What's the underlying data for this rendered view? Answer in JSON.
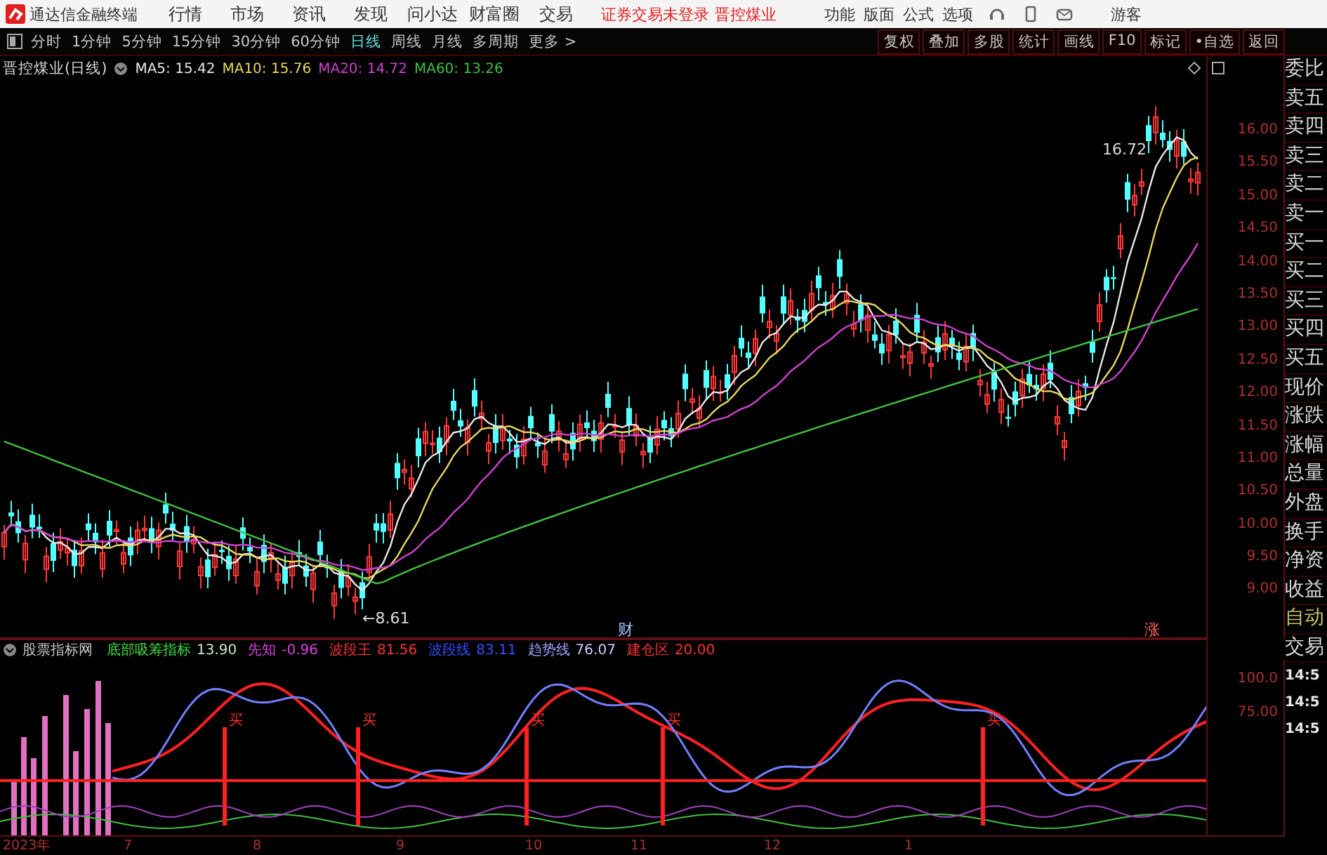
{
  "app_bar": {
    "title": "通达信金融终端",
    "menus": [
      "行情",
      "市场",
      "资讯",
      "发现",
      "问小达",
      "财富圈",
      "交易"
    ],
    "notice": "证券交易未登录",
    "stock_link": "晋控煤业",
    "tools": [
      "功能",
      "版面",
      "公式",
      "选项"
    ],
    "user": "游客"
  },
  "period_bar": {
    "periods": [
      {
        "label": "分时",
        "selected": false
      },
      {
        "label": "1分钟",
        "selected": false
      },
      {
        "label": "5分钟",
        "selected": false
      },
      {
        "label": "15分钟",
        "selected": false
      },
      {
        "label": "30分钟",
        "selected": false
      },
      {
        "label": "60分钟",
        "selected": false
      },
      {
        "label": "日线",
        "selected": true
      },
      {
        "label": "周线",
        "selected": false
      },
      {
        "label": "月线",
        "selected": false
      },
      {
        "label": "多周期",
        "selected": false
      }
    ],
    "more": "更多 >",
    "actions": [
      "复权",
      "叠加",
      "多股",
      "统计",
      "画线",
      "F10",
      "标记",
      "•自选",
      "返回"
    ]
  },
  "main_chart": {
    "title": "晋控煤业(日线)",
    "ma": [
      {
        "label": "MA5: 15.42",
        "color": "#e8e8e8"
      },
      {
        "label": "MA10: 15.76",
        "color": "#e8d860"
      },
      {
        "label": "MA20: 14.72",
        "color": "#d040d0"
      },
      {
        "label": "MA60: 13.26",
        "color": "#40c040"
      }
    ],
    "high_label": "16.72",
    "low_label": "←8.61",
    "event_marks": [
      {
        "text": "财",
        "color": "#a0c8ff"
      },
      {
        "text": "涨",
        "color": "#ff6060"
      }
    ],
    "price_labels": [
      "16.00",
      "15.50",
      "15.00",
      "14.50",
      "14.00",
      "13.50",
      "13.00",
      "12.50",
      "12.00",
      "11.50",
      "11.00",
      "10.50",
      "10.00",
      "9.50",
      "9.00"
    ]
  },
  "indicator": {
    "source": "股票指标网",
    "items": [
      {
        "text": "底部吸筹指标",
        "color": "#40e040"
      },
      {
        "text": "13.90",
        "color": "#c8e8c8"
      },
      {
        "text": "先知",
        "color": "#e040e0"
      },
      {
        "text": "-0.96",
        "color": "#e040e0"
      },
      {
        "text": "波段王",
        "color": "#ff3030"
      },
      {
        "text": "81.56",
        "color": "#ff3030"
      },
      {
        "text": "波段线",
        "color": "#3050ff"
      },
      {
        "text": "83.11",
        "color": "#3050ff"
      },
      {
        "text": "趋势线",
        "color": "#a0a0ff"
      },
      {
        "text": "76.07",
        "color": "#d0d0ff"
      },
      {
        "text": "建仓区",
        "color": "#ff3030"
      },
      {
        "text": "20.00",
        "color": "#ff3030"
      }
    ],
    "signals": [
      "买",
      "买",
      "买",
      "买",
      "买"
    ],
    "axis_labels": [
      "100.0",
      "75.00"
    ]
  },
  "x_axis": [
    "2023年",
    "7",
    "8",
    "9",
    "10",
    "11",
    "12",
    "1"
  ],
  "quote_panel": {
    "labels": [
      "委比",
      "卖五",
      "卖四",
      "卖三",
      "卖二",
      "卖一",
      "买一",
      "买二",
      "买三",
      "买四",
      "买五",
      "现价",
      "涨跌",
      "涨幅",
      "总量",
      "外盘",
      "换手",
      "净资",
      "收益"
    ],
    "auto": "自动",
    "trade": "交易",
    "times": [
      "14:5",
      "14:5",
      "14:5"
    ]
  }
}
